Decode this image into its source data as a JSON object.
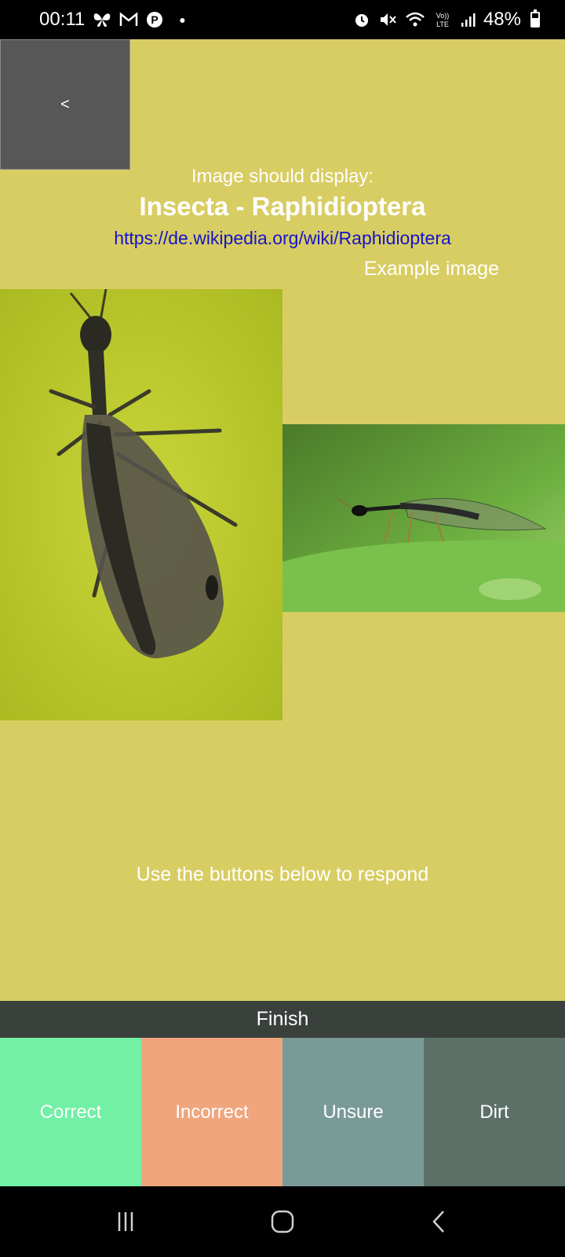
{
  "status_bar": {
    "time": "00:11",
    "battery": "48%",
    "notification_icons": [
      "butterfly-icon",
      "mail-icon",
      "pinterest-icon",
      "dot-icon"
    ],
    "system_icons": [
      "alarm-icon",
      "mute-icon",
      "wifi-icon",
      "volte-icon",
      "signal-icon",
      "battery-icon"
    ]
  },
  "back_button": {
    "label": "<"
  },
  "header": {
    "prompt": "Image should display:",
    "species": "Insecta - Raphidioptera",
    "link": "https://de.wikipedia.org/wiki/Raphidioptera",
    "example_label": "Example image"
  },
  "instructions": "Use the buttons below to respond",
  "finish_button": {
    "label": "Finish"
  },
  "responses": [
    {
      "label": "Correct",
      "color": "#71f0a6"
    },
    {
      "label": "Incorrect",
      "color": "#f0a57c"
    },
    {
      "label": "Unsure",
      "color": "#7a9a97"
    },
    {
      "label": "Dirt",
      "color": "#5c7067"
    }
  ],
  "colors": {
    "background": "#d8cd63",
    "link": "#1614c9",
    "finish_bar": "#3a403c",
    "back_button": "#575757"
  }
}
